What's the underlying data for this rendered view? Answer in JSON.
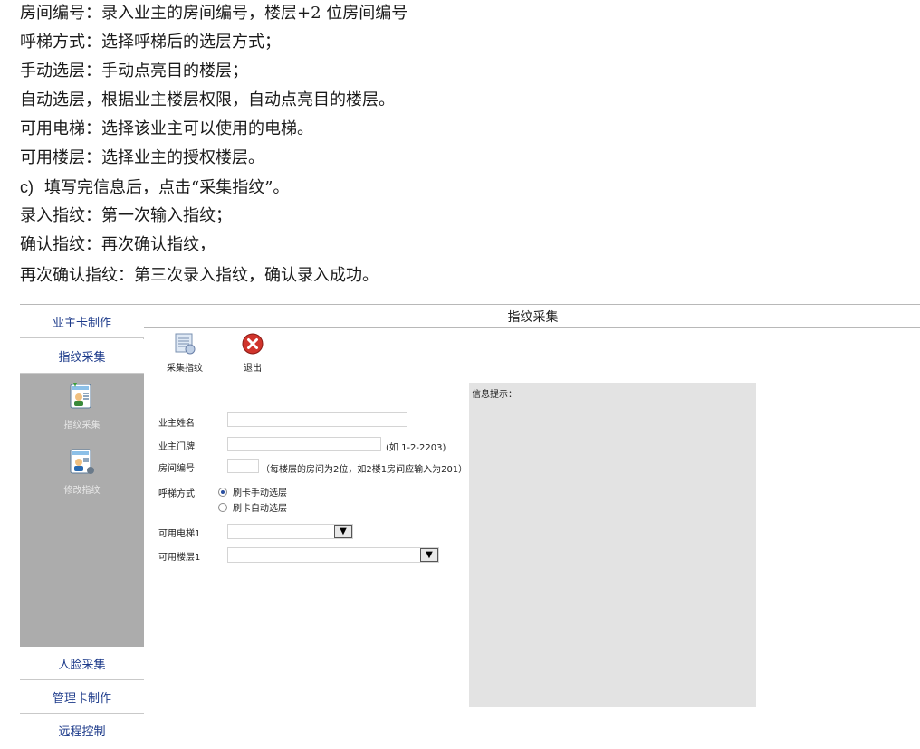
{
  "doc": {
    "lines": [
      "房间编号：录入业主的房间编号，楼层+2 位房间编号",
      "呼梯方式：选择呼梯后的选层方式；",
      "手动选层：手动点亮目的楼层；",
      "自动选层，根据业主楼层权限，自动点亮目的楼层。",
      "可用电梯：选择该业主可以使用的电梯。",
      "可用楼层：选择业主的授权楼层。",
      "填写完信息后，点击“采集指纹”。",
      "录入指纹：第一次输入指纹；",
      "确认指纹：再次确认指纹，",
      "再次确认指纹：第三次录入指纹，确认录入成功。"
    ],
    "list_marker": "c)"
  },
  "app": {
    "window_title": "指纹采集",
    "sidebar": {
      "top_items": [
        "业主卡制作",
        "指纹采集"
      ],
      "panel_items": [
        {
          "label": "指纹采集",
          "icon": "fingerprint-collect-icon"
        },
        {
          "label": "修改指纹",
          "icon": "fingerprint-edit-icon"
        }
      ],
      "bottom_items": [
        "人脸采集",
        "管理卡制作",
        "远程控制"
      ]
    },
    "toolbar": {
      "collect_label": "采集指纹",
      "exit_label": "退出"
    },
    "form": {
      "owner_name_label": "业主姓名",
      "owner_name_value": "",
      "door_label": "业主门牌",
      "door_value": "",
      "door_hint": "(如 1-2-2203)",
      "room_label": "房间编号",
      "room_value": "",
      "room_hint": "（每楼层的房间为2位，如2楼1房间应输入为201）",
      "call_mode_label": "呼梯方式",
      "call_mode_options": [
        "刷卡手动选层",
        "刷卡自动选层"
      ],
      "call_mode_selected": "刷卡手动选层",
      "elevator_label": "可用电梯1",
      "elevator_value": "",
      "floor_label": "可用楼层1",
      "floor_value": ""
    },
    "info": {
      "title": "信息提示："
    }
  },
  "colors": {
    "nav_text": "#1c3a8a",
    "panel_bg": "#acacac",
    "info_bg": "#e3e3e3",
    "exit_red": "#d0342c"
  }
}
